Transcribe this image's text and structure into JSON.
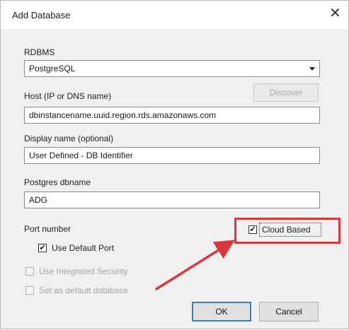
{
  "window": {
    "title": "Add Database",
    "close_glyph": "✕"
  },
  "rdbms": {
    "label": "RDBMS",
    "selected": "PostgreSQL"
  },
  "host": {
    "label": "Host (IP or DNS name)",
    "value": "dbinstancename.uuid.region.rds.amazonaws.com",
    "discover_label": "Discover"
  },
  "display_name": {
    "label": "Display name (optional)",
    "value": "User Defined - DB Identifier"
  },
  "postgres_dbname": {
    "label": "Postgres dbname",
    "value": "ADG"
  },
  "port": {
    "label": "Port number",
    "use_default_label": "Use Default Port",
    "use_default_checked": true
  },
  "cloud_based": {
    "label": "Cloud Based",
    "checked": true
  },
  "integrated_security": {
    "label": "Use Integrated Security",
    "checked": false,
    "enabled": false
  },
  "default_database": {
    "label": "Set as default database",
    "checked": false,
    "enabled": false
  },
  "buttons": {
    "ok": "OK",
    "cancel": "Cancel"
  },
  "checkmark": "✔",
  "colors": {
    "highlight": "#d9363e",
    "dialog_bg": "#f0f0f0"
  }
}
